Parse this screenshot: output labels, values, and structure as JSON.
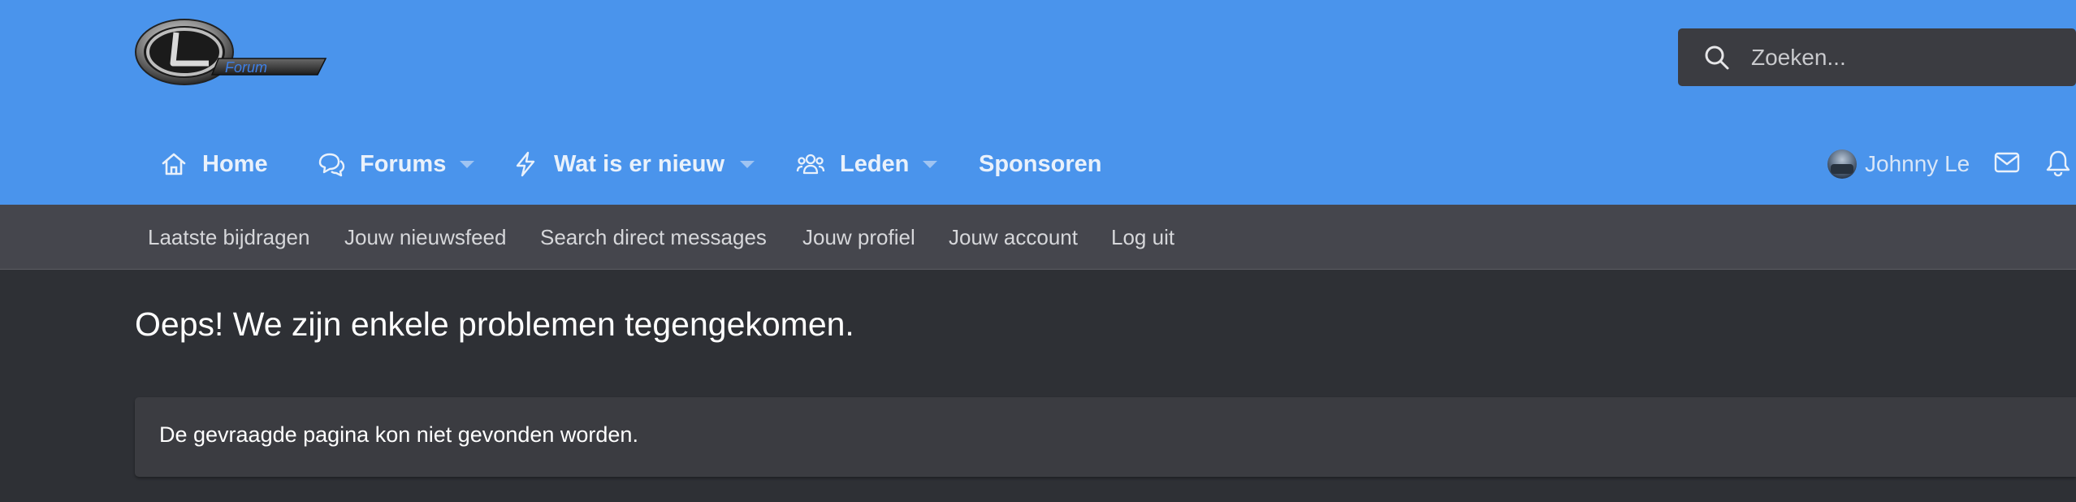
{
  "header": {
    "logo_text": "Forum",
    "search_placeholder": "Zoeken..."
  },
  "nav": {
    "items": [
      {
        "label": "Home",
        "icon": "home-icon",
        "has_dropdown": false
      },
      {
        "label": "Forums",
        "icon": "chat-icon",
        "has_dropdown": true
      },
      {
        "label": "Wat is er nieuw",
        "icon": "bolt-icon",
        "has_dropdown": true
      },
      {
        "label": "Leden",
        "icon": "users-icon",
        "has_dropdown": true
      },
      {
        "label": "Sponsoren",
        "icon": "",
        "has_dropdown": false
      }
    ],
    "user_name": "Johnny Le"
  },
  "subnav": {
    "items": [
      "Laatste bijdragen",
      "Jouw nieuwsfeed",
      "Search direct messages",
      "Jouw profiel",
      "Jouw account",
      "Log uit"
    ]
  },
  "content": {
    "title": "Oeps! We zijn enkele problemen tegengekomen.",
    "message": "De gevraagde pagina kon niet gevonden worden."
  },
  "colors": {
    "header_bg": "#4a94ec",
    "subnav_bg": "#45464d",
    "page_bg": "#2e3035",
    "block_bg": "#3b3c41"
  }
}
